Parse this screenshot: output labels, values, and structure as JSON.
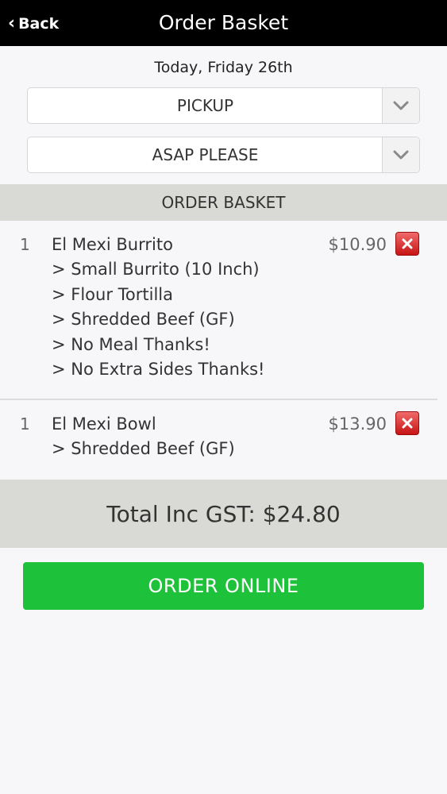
{
  "header": {
    "back_label": "Back",
    "title": "Order Basket"
  },
  "date_text": "Today, Friday 26th",
  "delivery_select": {
    "value": "PICKUP"
  },
  "time_select": {
    "value": "ASAP PLEASE"
  },
  "basket": {
    "heading": "ORDER BASKET",
    "items": [
      {
        "qty": "1",
        "name": "El Mexi Burrito",
        "price": "$10.90",
        "options": [
          "> Small Burrito (10 Inch)",
          "> Flour Tortilla",
          "> Shredded Beef (GF)",
          "> No Meal Thanks!",
          "> No Extra Sides Thanks!"
        ]
      },
      {
        "qty": "1",
        "name": "El Mexi Bowl",
        "price": "$13.90",
        "options": [
          "> Shredded Beef (GF)"
        ]
      }
    ]
  },
  "total_text": "Total Inc GST: $24.80",
  "order_button_label": "ORDER ONLINE",
  "colors": {
    "header_bg": "#000000",
    "section_bg": "#d9d9d6",
    "order_button": "#1ec23a",
    "delete_button": "#d32020"
  }
}
